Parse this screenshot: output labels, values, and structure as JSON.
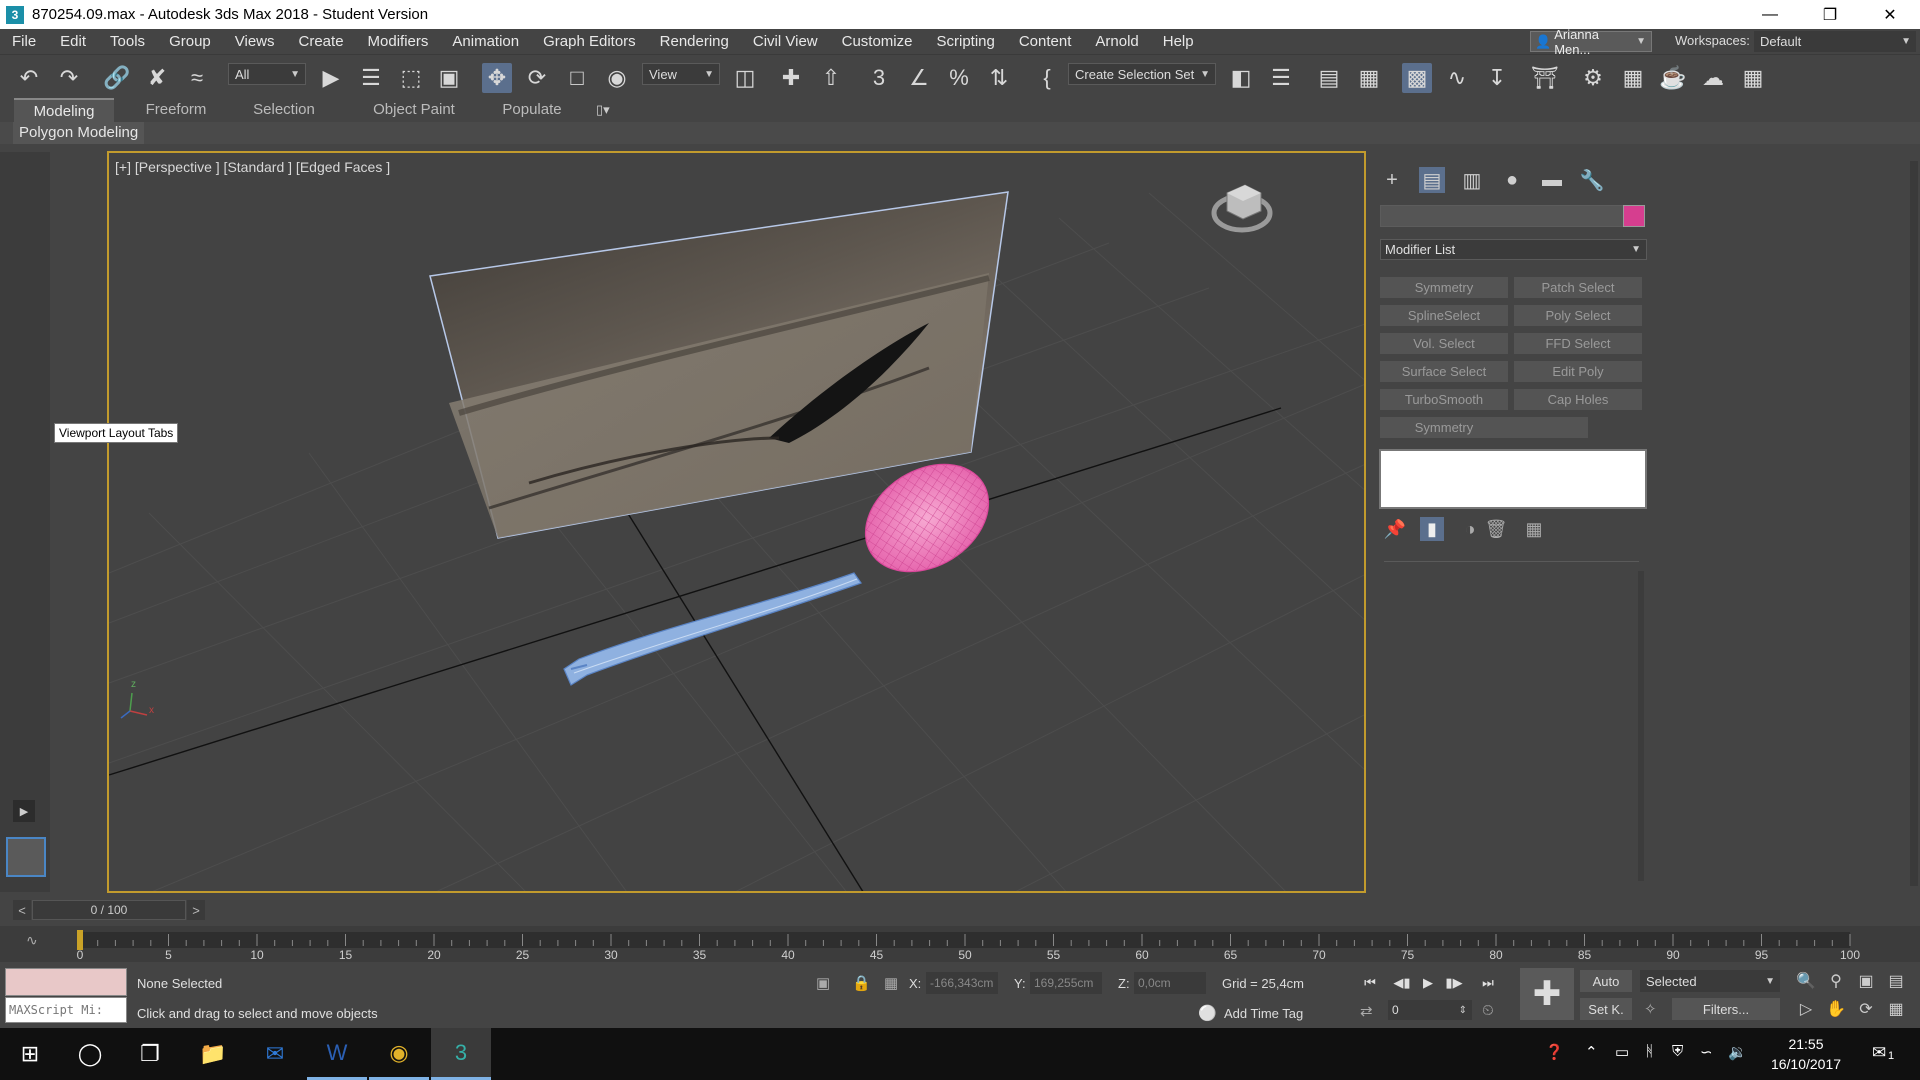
{
  "window": {
    "title": "870254.09.max - Autodesk 3ds Max 2018 - Student Version",
    "app_icon_label": "3"
  },
  "menu": {
    "items": [
      "File",
      "Edit",
      "Tools",
      "Group",
      "Views",
      "Create",
      "Modifiers",
      "Animation",
      "Graph Editors",
      "Rendering",
      "Civil View",
      "Customize",
      "Scripting",
      "Content",
      "Arnold",
      "Help"
    ],
    "user": "Arianna Men...",
    "workspaces_label": "Workspaces:",
    "workspace_value": "Default"
  },
  "toolbar": {
    "filter_value": "All",
    "refcoord_value": "View",
    "selection_set_value": "Create Selection Set"
  },
  "ribbon": {
    "tabs": [
      "Modeling",
      "Freeform",
      "Selection",
      "Object Paint",
      "Populate"
    ],
    "active_tab": "Modeling",
    "panel_label": "Polygon Modeling"
  },
  "viewport": {
    "label": "[+] [Perspective ] [Standard ] [Edged Faces ]",
    "tooltip": "Viewport Layout Tabs",
    "axis_x": "x",
    "axis_z": "z"
  },
  "command_panel": {
    "object_color": "#d63e8f",
    "modifier_list_label": "Modifier List",
    "modifier_buttons": [
      "Symmetry",
      "Patch Select",
      "SplineSelect",
      "Poly Select",
      "Vol. Select",
      "FFD Select",
      "Surface Select",
      "Edit Poly",
      "TurboSmooth",
      "Cap Holes",
      "Symmetry",
      ""
    ]
  },
  "time_slider": {
    "frame_display": "0 / 100",
    "prev": "<",
    "next": ">"
  },
  "track_bar": {
    "tick_labels": [
      "0",
      "5",
      "10",
      "15",
      "20",
      "25",
      "30",
      "35",
      "40",
      "45",
      "50",
      "55",
      "60",
      "65",
      "70",
      "75",
      "80",
      "85",
      "90",
      "95",
      "100"
    ]
  },
  "status": {
    "selection": "None Selected",
    "prompt": "Click and drag to select and move objects",
    "maxscript": "MAXScript Mi:",
    "x_label": "X:",
    "x_value": "-166,343cm",
    "y_label": "Y:",
    "y_value": "169,255cm",
    "z_label": "Z:",
    "z_value": "0,0cm",
    "grid": "Grid = 25,4cm",
    "add_time_tag": "Add Time Tag",
    "frame_value": "0",
    "auto_key": "Auto",
    "set_key": "Set K.",
    "key_filter_value": "Selected",
    "filters": "Filters..."
  },
  "taskbar": {
    "time": "21:55",
    "date": "16/10/2017",
    "notification_count": "1"
  }
}
